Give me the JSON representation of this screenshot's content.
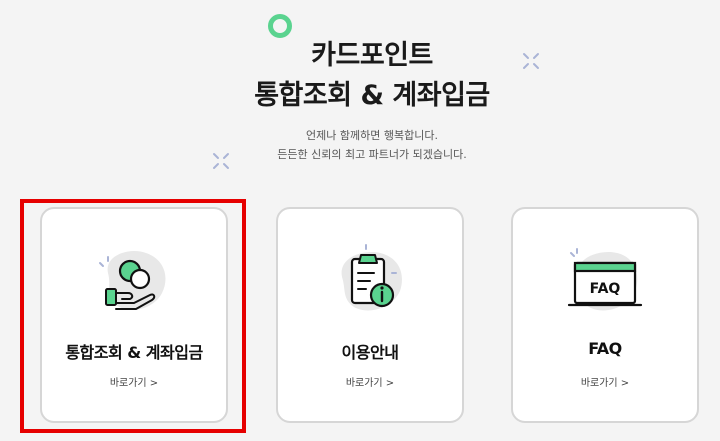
{
  "hero": {
    "title_line1": "카드포인트",
    "title_line2": "통합조회 & 계좌입금",
    "subtitle_line1": "언제나 함께하면 행복합니다.",
    "subtitle_line2": "든든한 신뢰의 최고 파트너가 되겠습니다."
  },
  "cards": [
    {
      "title": "통합조회 & 계좌입금",
      "link": "바로가기 >",
      "icon": "coin-hand-icon",
      "selected": true
    },
    {
      "title": "이용안내",
      "link": "바로가기 >",
      "icon": "clipboard-info-icon",
      "selected": false
    },
    {
      "title": "FAQ",
      "link": "바로가기 >",
      "icon": "faq-window-icon",
      "selected": false
    }
  ],
  "icon_text": {
    "faq_window": "FAQ"
  },
  "colors": {
    "accent_green": "#5ad38f",
    "highlight_red": "#e60000",
    "blob_gray": "#e8e8e8",
    "sparkle_blue": "#aab4d6"
  }
}
